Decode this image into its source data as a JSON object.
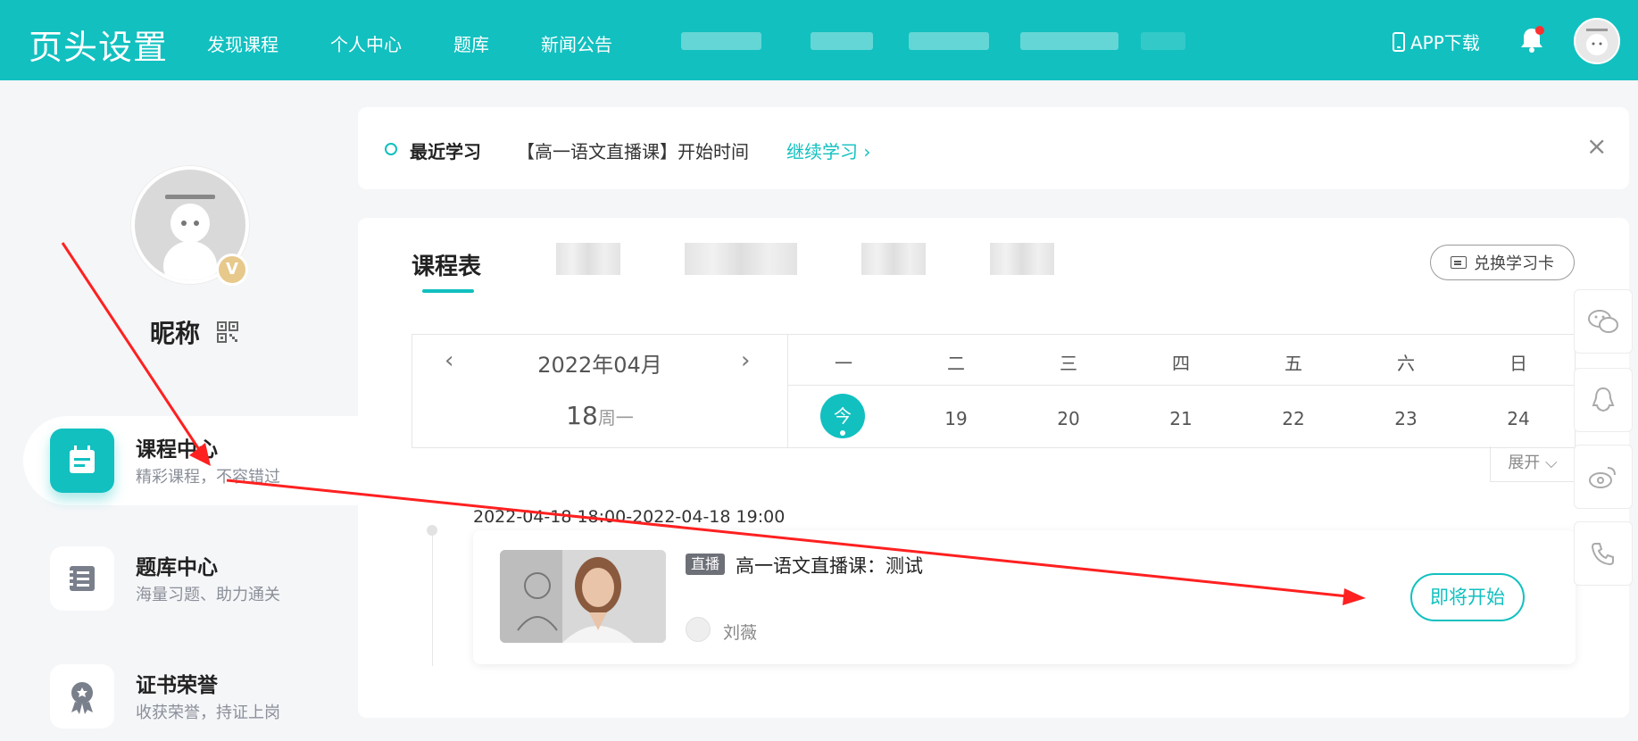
{
  "topbar": {
    "logo": "页头设置",
    "nav": [
      "发现课程",
      "个人中心",
      "题库",
      "新闻公告"
    ],
    "app_download": "APP下载"
  },
  "sidebar": {
    "nickname": "昵称",
    "badge": "V",
    "menu": [
      {
        "title": "课程中心",
        "subtitle": "精彩课程，不容错过"
      },
      {
        "title": "题库中心",
        "subtitle": "海量习题、助力通关"
      },
      {
        "title": "证书荣誉",
        "subtitle": "收获荣誉，持证上岗"
      }
    ]
  },
  "recent": {
    "label": "最近学习",
    "course": "【高一语文直播课】开始时间",
    "continue": "继续学习 ›",
    "close": "×"
  },
  "main": {
    "tab_active": "课程表",
    "redeem_label": "兑换学习卡",
    "calendar": {
      "month": "2022年04月",
      "prev": "‹",
      "next": "›",
      "day_num": "18",
      "day_week": "周一",
      "weekdays": [
        "一",
        "二",
        "三",
        "四",
        "五",
        "六",
        "日"
      ],
      "dates": [
        "今",
        "19",
        "20",
        "21",
        "22",
        "23",
        "24"
      ],
      "expand": "展开 ⌵"
    },
    "lesson": {
      "time_range": "2022-04-18 18:00-2022-04-18 19:00",
      "tag": "直播",
      "title": "高一语文直播课：测试",
      "teacher": "刘薇",
      "status_button": "即将开始"
    }
  },
  "colors": {
    "accent": "#12c0c0",
    "annotation": "#ff2020"
  },
  "icons": {
    "float": [
      "wechat-icon",
      "qq-icon",
      "weibo-icon",
      "phone-icon"
    ]
  }
}
